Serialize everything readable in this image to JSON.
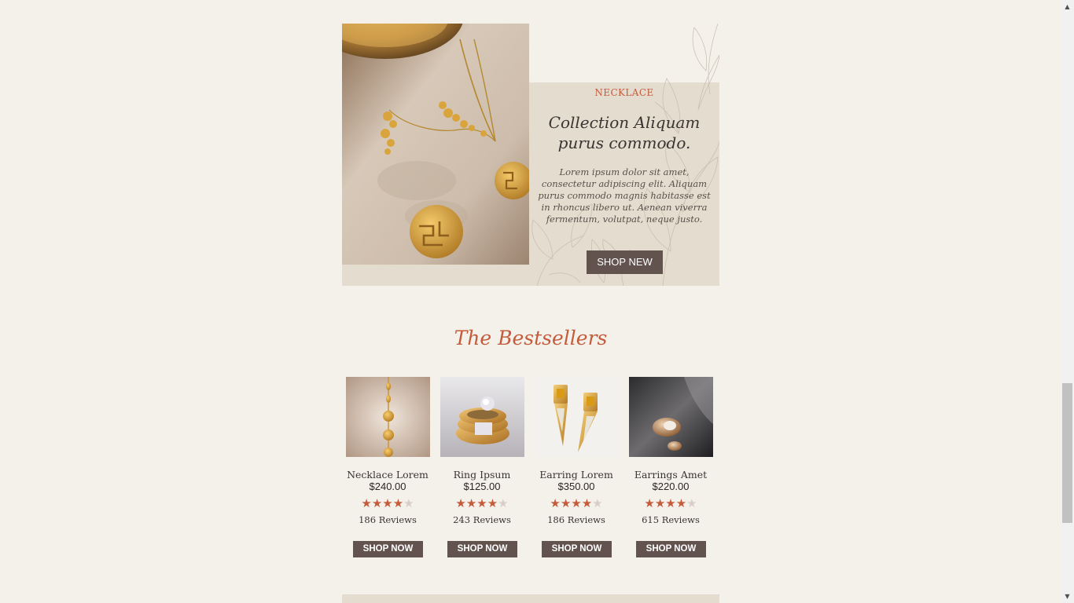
{
  "hero": {
    "label": "NECKLACE",
    "title": "Collection Aliquam purus commodo.",
    "body": "Lorem ipsum dolor sit amet, consectetur adipiscing elit. Aliquam purus commodo magnis habitasse est in rhoncus libero ut. Aenean viverra fermentum, volutpat, neque justo.",
    "button_label": "SHOP NEW"
  },
  "bestsellers": {
    "title": "The Bestsellers",
    "products": [
      {
        "name": "Necklace Lorem",
        "price": "$240.00",
        "rating": 4,
        "max_rating": 5,
        "reviews": "186 Reviews",
        "button_label": "SHOP NOW"
      },
      {
        "name": "Ring Ipsum",
        "price": "$125.00",
        "rating": 4,
        "max_rating": 5,
        "reviews": "243 Reviews",
        "button_label": "SHOP NOW"
      },
      {
        "name": "Earring Lorem",
        "price": "$350.00",
        "rating": 4,
        "max_rating": 5,
        "reviews": "186 Reviews",
        "button_label": "SHOP NOW"
      },
      {
        "name": "Earrings Amet",
        "price": "$220.00",
        "rating": 4,
        "max_rating": 5,
        "reviews": "615 Reviews",
        "button_label": "SHOP NOW"
      }
    ]
  },
  "scrollbar": {
    "up_icon": "triangle-up-icon",
    "down_icon": "triangle-down-icon",
    "position": 0.73
  },
  "colors": {
    "background": "#f4f0ea",
    "panel": "#e3dccf",
    "accent": "#c45c3c",
    "button": "#62534e",
    "star_off": "#d9cec7"
  }
}
